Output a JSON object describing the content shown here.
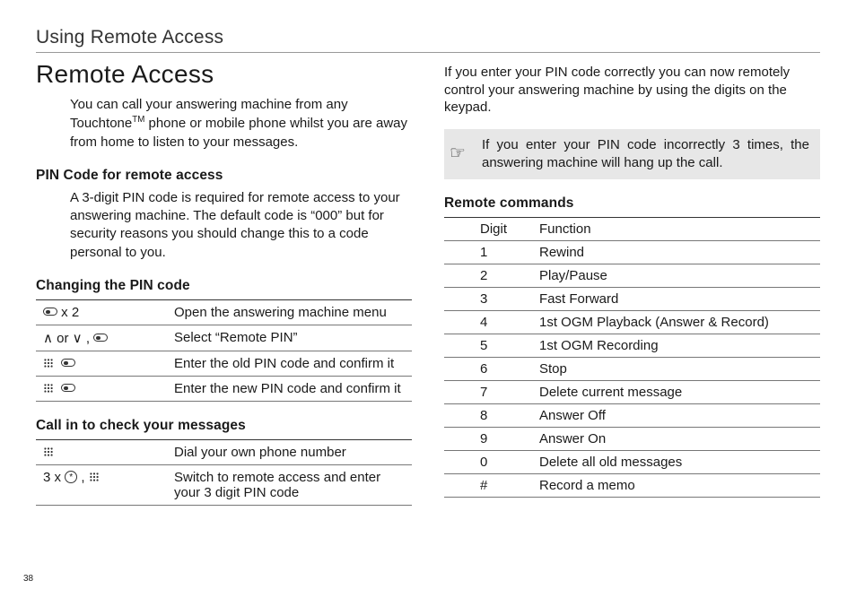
{
  "page_header": "Using Remote Access",
  "title": "Remote Access",
  "intro_html": "You can call your answering machine from any Touchtone<span class='sup'>TM</span> phone or mobile phone whilst you are away from home to listen to your messages.",
  "section_pin": {
    "heading": "PIN Code for remote access",
    "text": "A 3-digit PIN code is required for remote access to your answering machine. The default code is “000” but for security reasons you should change this to a code personal to you."
  },
  "section_change": {
    "heading": "Changing the PIN code",
    "rows": [
      {
        "key_html": "<span class='icon-oval'></span> x 2",
        "val": "Open the answering machine menu"
      },
      {
        "key_html": "<span class='sym'>&#8743;</span> or <span class='sym'>&#8744;</span> , <span class='icon-oval'></span>",
        "val": "Select “Remote PIN”"
      },
      {
        "key_html": "<span class='icon-keypad'></span> &nbsp;<span class='icon-oval'></span>",
        "val": "Enter the old PIN code and confirm it"
      },
      {
        "key_html": "<span class='icon-keypad'></span> &nbsp;<span class='icon-oval'></span>",
        "val": "Enter the new PIN code and confirm it"
      }
    ]
  },
  "section_callin": {
    "heading": "Call in to check your messages",
    "rows": [
      {
        "key_html": "<span class='icon-keypad'></span>",
        "val": "Dial your own phone number"
      },
      {
        "key_html": "3 x <span class='icon-star'>*</span> , <span class='icon-keypad'></span>",
        "val": "Switch to remote access and enter your 3 digit PIN code"
      }
    ]
  },
  "right_intro": "If you enter your PIN code correctly you can now remotely control your answering machine by using the digits on the keypad.",
  "callout": {
    "icon": "☞",
    "text": "If you enter your PIN code incorrectly 3 times, the answering machine will hang up the call."
  },
  "section_commands": {
    "heading": "Remote commands",
    "head": {
      "c1": "Digit",
      "c2": "Function"
    },
    "rows": [
      {
        "d": "1",
        "f": "Rewind"
      },
      {
        "d": "2",
        "f": "Play/Pause"
      },
      {
        "d": "3",
        "f": "Fast Forward"
      },
      {
        "d": "4",
        "f": "1st OGM Playback (Answer & Record)"
      },
      {
        "d": "5",
        "f": "1st OGM Recording"
      },
      {
        "d": "6",
        "f": "Stop"
      },
      {
        "d": "7",
        "f": "Delete current message"
      },
      {
        "d": "8",
        "f": "Answer Off"
      },
      {
        "d": "9",
        "f": "Answer On"
      },
      {
        "d": "0",
        "f": "Delete all old messages"
      },
      {
        "d": "#",
        "f": "Record a memo"
      }
    ]
  },
  "pagenum": "38"
}
